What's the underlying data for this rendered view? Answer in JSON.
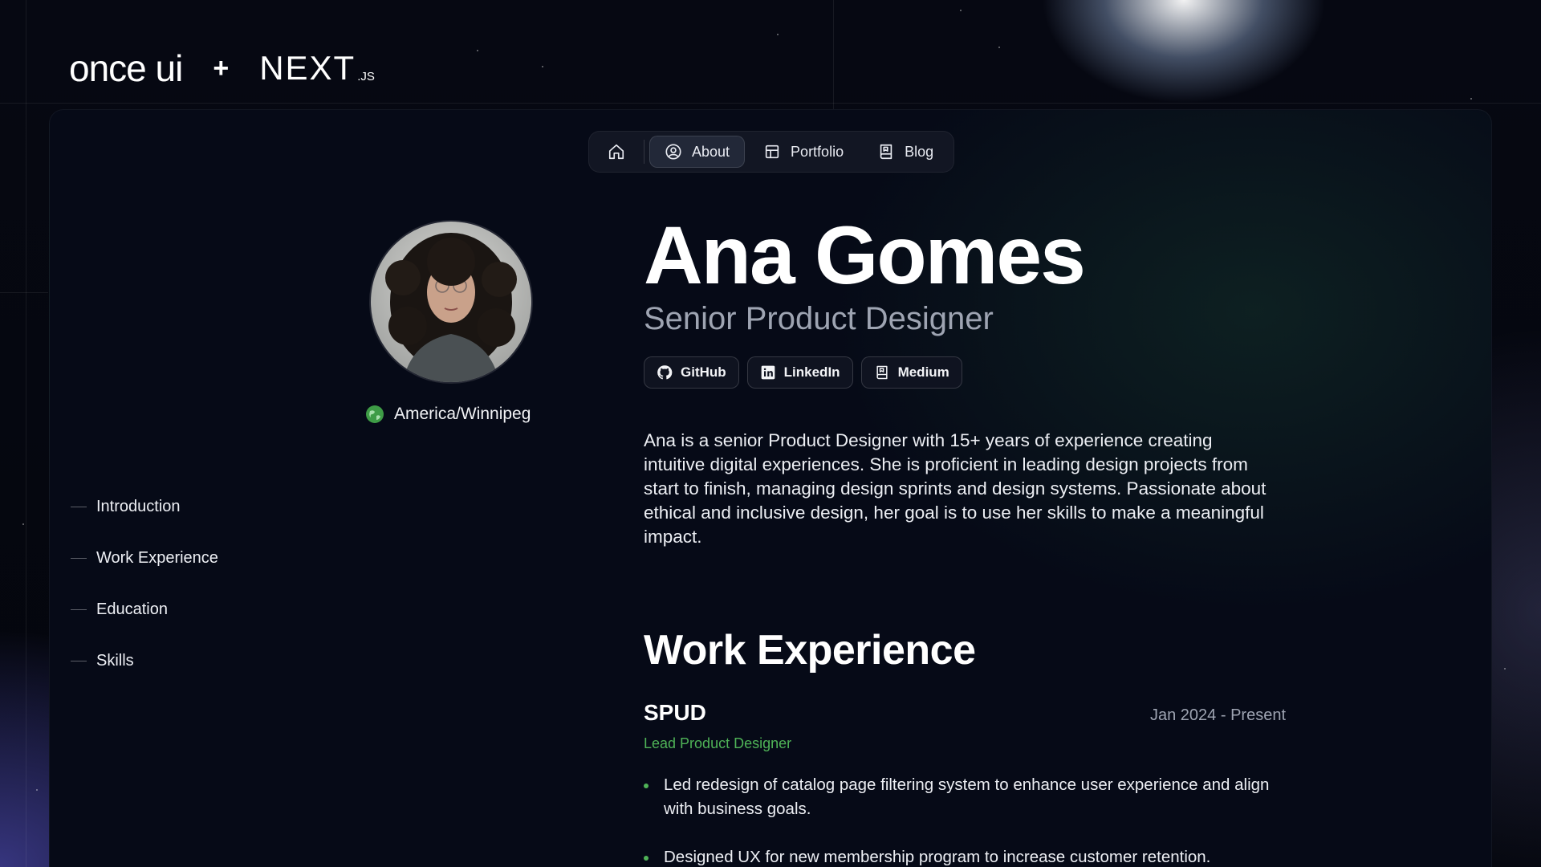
{
  "brand": {
    "once_ui": "once ui",
    "plus": "+",
    "next": "NEXT",
    "next_suffix": ".JS"
  },
  "nav": {
    "home_icon": "home-icon",
    "items": [
      {
        "label": "About",
        "icon": "person-icon",
        "active": true
      },
      {
        "label": "Portfolio",
        "icon": "grid-icon",
        "active": false
      },
      {
        "label": "Blog",
        "icon": "book-icon",
        "active": false
      }
    ]
  },
  "profile": {
    "name": "Ana Gomes",
    "role": "Senior Product Designer",
    "location": "America/Winnipeg",
    "avatar": "avatar-photo"
  },
  "socials": [
    {
      "label": "GitHub",
      "icon": "github-icon"
    },
    {
      "label": "LinkedIn",
      "icon": "linkedin-icon"
    },
    {
      "label": "Medium",
      "icon": "medium-icon"
    }
  ],
  "toc": [
    "Introduction",
    "Work Experience",
    "Education",
    "Skills"
  ],
  "intro": "Ana is a senior Product Designer with 15+ years of experience creating intuitive digital experiences. She is proficient in leading design projects from start to finish, managing design sprints and design systems. Passionate about ethical and inclusive design, her goal is to use her skills to make a meaningful impact.",
  "work": {
    "title": "Work Experience",
    "jobs": [
      {
        "company": "SPUD",
        "dates": "Jan 2024 - Present",
        "role": "Lead Product Designer",
        "bullets": [
          "Led redesign of catalog page filtering system to enhance user experience and align with business goals.",
          "Designed UX for new membership program to increase customer retention."
        ]
      }
    ]
  },
  "colors": {
    "accent_green": "#4fb357",
    "muted_text": "#9ea4b2",
    "panel_bg": "#060a17"
  }
}
